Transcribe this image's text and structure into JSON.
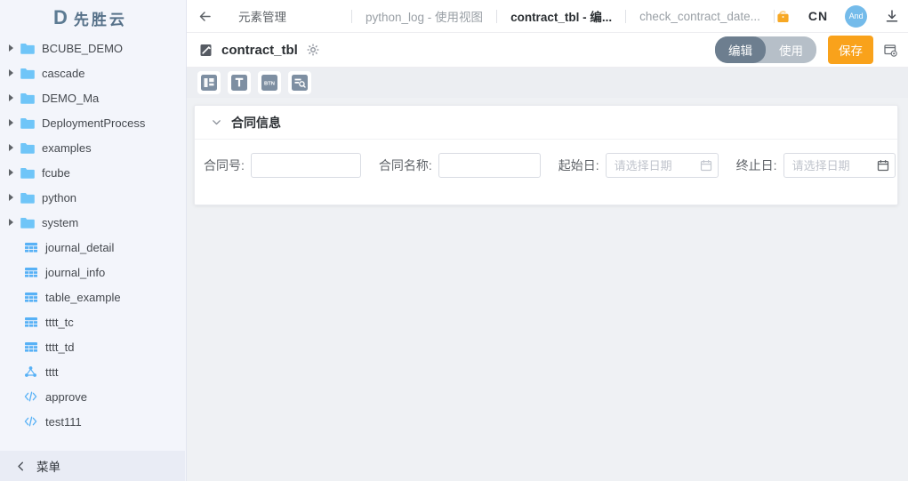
{
  "logo": {
    "mark": "D",
    "title": "先胜云"
  },
  "topbar": {
    "tabs": [
      {
        "label": "元素管理",
        "active": false
      },
      {
        "label": "python_log - 使用视图",
        "active": false
      },
      {
        "label": "contract_tbl - 编...",
        "active": true
      },
      {
        "label": "check_contract_date...",
        "active": false
      }
    ],
    "lang": "CN",
    "avatar_initials": "And"
  },
  "header": {
    "title": "contract_tbl",
    "mode_edit": "编辑",
    "mode_use": "使用",
    "save": "保存"
  },
  "toolbar": {
    "icons": [
      "layout-widget",
      "text-widget",
      "button-widget",
      "query-widget"
    ],
    "text_glyph": "T",
    "button_glyph": "BTN"
  },
  "sidebar": {
    "folders": [
      "BCUBE_DEMO",
      "cascade",
      "DEMO_Ma",
      "DeploymentProcess",
      "examples",
      "fcube",
      "python",
      "system"
    ],
    "leaves": [
      {
        "label": "journal_detail",
        "icon": "table-icon"
      },
      {
        "label": "journal_info",
        "icon": "table-icon"
      },
      {
        "label": "table_example",
        "icon": "table-icon"
      },
      {
        "label": "tttt_tc",
        "icon": "table-icon"
      },
      {
        "label": "tttt_td",
        "icon": "table-icon"
      },
      {
        "label": "tttt",
        "icon": "share-icon"
      },
      {
        "label": "approve",
        "icon": "code-icon"
      },
      {
        "label": "test111",
        "icon": "code-icon"
      }
    ],
    "collapse_label": "菜单"
  },
  "form": {
    "section_title": "合同信息",
    "fields": [
      {
        "label": "合同号:",
        "type": "text",
        "value": ""
      },
      {
        "label": "合同名称:",
        "type": "text",
        "value": ""
      },
      {
        "label": "起始日:",
        "type": "date",
        "value": "",
        "placeholder": "请选择日期"
      },
      {
        "label": "终止日:",
        "type": "date",
        "value": "",
        "placeholder": "请选择日期"
      }
    ]
  },
  "colors": {
    "accent_orange": "#f9a21b",
    "slate_active": "#6d7e8f",
    "slate_inactive": "#b6bfc8",
    "widget_slate": "#7e8fa2",
    "icon_blue": "#57b1f6",
    "folder_blue": "#6fc5f8",
    "avatar_blue": "#74bbea",
    "sidebar_bg": "#f3f5fb",
    "content_bg": "#eff1f4"
  }
}
